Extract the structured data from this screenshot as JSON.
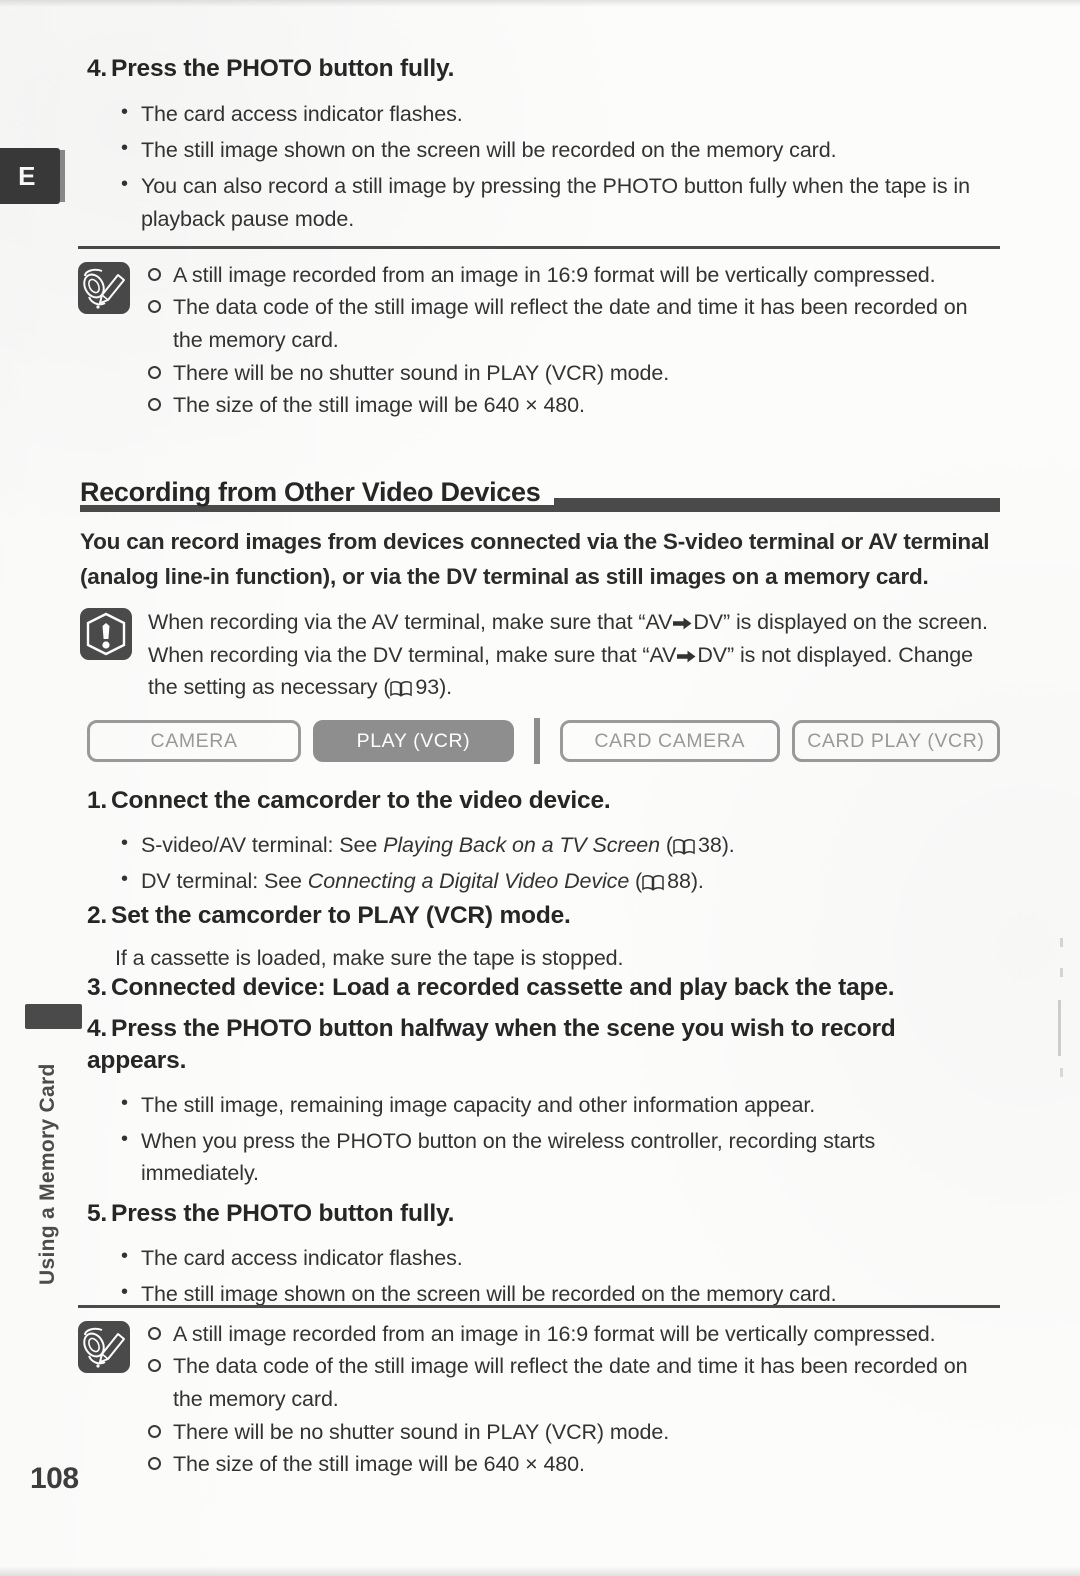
{
  "page": {
    "number": "108",
    "language_tab": "E",
    "chapter_tab_label": "Using a Memory Card"
  },
  "step4_top": {
    "heading_num": "4.",
    "heading_text": "Press the PHOTO button fully.",
    "bullets": [
      "The card access indicator flashes.",
      "The still image shown on the screen will be recorded on the memory card.",
      "You can also record a still image by pressing the PHOTO button fully when the tape is in playback pause mode."
    ]
  },
  "notes_top": {
    "icon": "pencil-note-icon",
    "items": [
      "A still image recorded from an image in 16:9 format will be vertically compressed.",
      "The data code of the still image will reflect the date and time it has been recorded on the memory card.",
      "There will be no shutter sound in PLAY (VCR) mode.",
      "The size of the still image will be 640 × 480."
    ]
  },
  "section": {
    "title": "Recording from Other Video Devices",
    "lead": "You can record images from devices connected via the S-video terminal or AV terminal (analog line-in function), or via the DV terminal as still images on a memory card."
  },
  "caution": {
    "icon": "exclamation-hexagon-icon",
    "text_part1": "When recording via the AV terminal, make sure that “AV",
    "text_part2": "DV” is displayed on the screen. When recording via the DV terminal, make sure that “AV",
    "text_part3": "DV” is not displayed. Change the setting as necessary (",
    "ref_page": "93",
    "text_part4": ")."
  },
  "mode_bar": {
    "modes": [
      {
        "label": "CAMERA",
        "active": false
      },
      {
        "label": "PLAY (VCR)",
        "active": true
      },
      {
        "label": "CARD CAMERA",
        "active": false
      },
      {
        "label": "CARD PLAY (VCR)",
        "active": false
      }
    ]
  },
  "steps": [
    {
      "num": "1.",
      "heading": "Connect the camcorder to the video device.",
      "bullets_rich": [
        {
          "pre": "S-video/AV terminal: See ",
          "italic": "Playing Back on a TV Screen",
          "mid": " (",
          "ref": "38",
          "post": ")."
        },
        {
          "pre": "DV terminal: See ",
          "italic": "Connecting a Digital Video Device",
          "mid": " (",
          "ref": "88",
          "post": ")."
        }
      ]
    },
    {
      "num": "2.",
      "heading": "Set the camcorder to PLAY (VCR) mode.",
      "note": "If a cassette is loaded, make sure the tape is stopped."
    },
    {
      "num": "3.",
      "heading": "Connected device: Load a recorded cassette and play back the tape."
    },
    {
      "num": "4.",
      "heading": "Press the PHOTO button halfway when the scene you wish to record appears.",
      "bullets": [
        "The still image, remaining image capacity and other information appear.",
        "When you press the PHOTO button on the wireless controller, recording starts immediately."
      ]
    },
    {
      "num": "5.",
      "heading": "Press the PHOTO button fully.",
      "bullets": [
        "The card access indicator flashes.",
        "The still image shown on the screen will be recorded on the memory card."
      ]
    }
  ],
  "notes_bottom": {
    "icon": "pencil-note-icon",
    "items": [
      "A still image recorded from an image in 16:9 format will be vertically compressed.",
      "The data code of the still image will reflect the date and time it has been recorded on the memory card.",
      "There will be no shutter sound in PLAY (VCR) mode.",
      "The size of the still image will be 640 × 480."
    ]
  },
  "colors": {
    "ink": "#2e2e2e",
    "rule": "#4a4a4a",
    "pill_border": "#9a9a9a",
    "pill_active_bg": "#8e8e8e",
    "paper": "#fcfcfb"
  }
}
